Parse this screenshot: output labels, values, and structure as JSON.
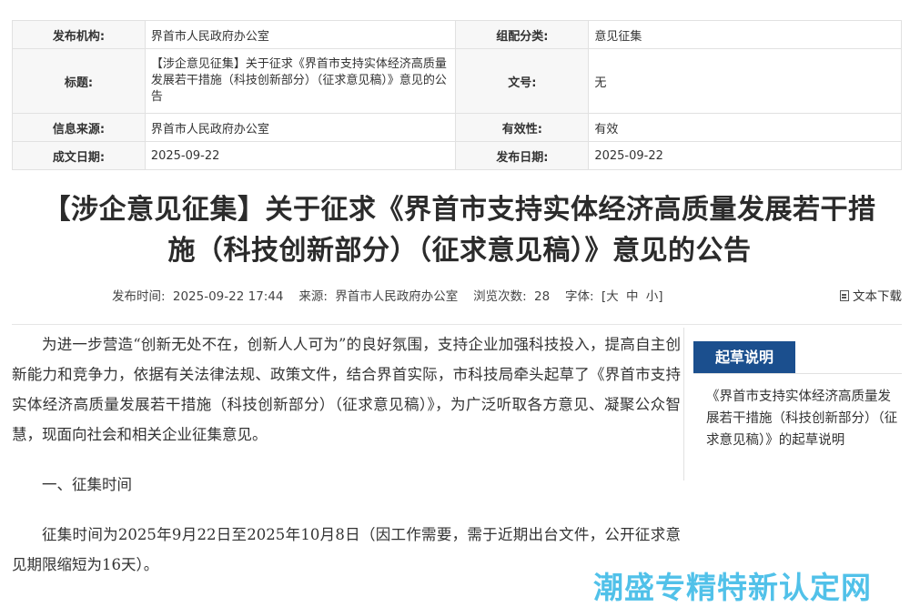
{
  "meta": {
    "publisher_label": "发布机构:",
    "publisher": "界首市人民政府办公室",
    "category_label": "组配分类:",
    "category": "意见征集",
    "title_label": "标题:",
    "title": "【涉企意见征集】关于征求《界首市支持实体经济高质量发展若干措施（科技创新部分）（征求意见稿）》意见的公告",
    "docno_label": "文号:",
    "docno": "无",
    "source_label": "信息来源:",
    "source": "界首市人民政府办公室",
    "validity_label": "有效性:",
    "validity": "有效",
    "written_date_label": "成文日期:",
    "written_date": "2025-09-22",
    "publish_date_label": "发布日期:",
    "publish_date": "2025-09-22"
  },
  "article": {
    "title_line1": "【涉企意见征集】关于征求《界首市支持实体经济高质量发展若干措",
    "title_line2": "施（科技创新部分）（征求意见稿）》意见的公告",
    "info": {
      "publish_time_label": "发布时间:",
      "publish_time": "2025-09-22 17:44",
      "source_label": "来源:",
      "source": "界首市人民政府办公室",
      "views_label": "浏览次数:",
      "views": "28",
      "font_label": "字体:",
      "font_open": "[",
      "font_large": "大",
      "font_medium": "中",
      "font_small": "小",
      "font_close": "]",
      "download_label": "文本下载"
    },
    "paragraphs": {
      "p1": "为进一步营造“创新无处不在，创新人人可为”的良好氛围，支持企业加强科技投入，提高自主创新能力和竞争力，依据有关法律法规、政策文件，结合界首实际，市科技局牵头起草了《界首市支持实体经济高质量发展若干措施（科技创新部分）（征求意见稿）》，为广泛听取各方意见、凝聚公众智慧，现面向社会和相关企业征集意见。",
      "s1": "一、征集时间",
      "p2": "征集时间为2025年9月22日至2025年10月8日（因工作需要，需于近期出台文件，公开征求意见期限缩短为16天）。"
    }
  },
  "sidebar": {
    "tab_label": "起草说明",
    "link_text": "《界首市支持实体经济高质量发展若干措施（科技创新部分）（征求意见稿）》的起草说明"
  },
  "watermark": {
    "text": "潮盛专精特新认定网"
  },
  "colors": {
    "accent": "#1b4f8e",
    "watermark": "#33b7e6",
    "label_bg": "#f7f7f7"
  },
  "icons": {
    "download": "document-icon"
  }
}
